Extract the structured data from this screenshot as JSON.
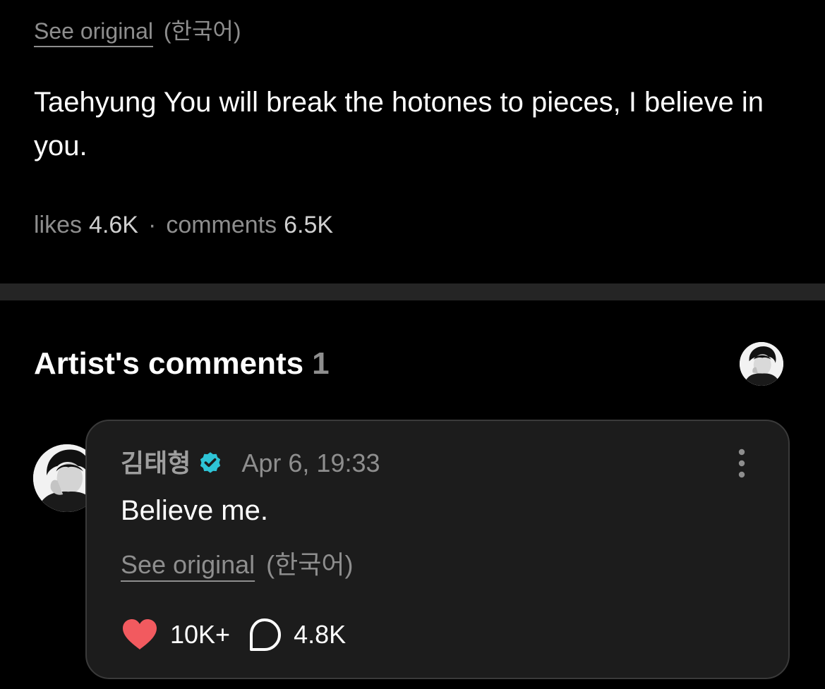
{
  "post": {
    "see_original_label": "See original",
    "original_language": "(한국어)",
    "text": "Taehyung You will break the hotones to pieces, I believe in you.",
    "stats": {
      "likes_label": "likes",
      "likes_count": "4.6K",
      "separator": "·",
      "comments_label": "comments",
      "comments_count": "6.5K"
    }
  },
  "artist_comments": {
    "heading": "Artist's comments",
    "count": "1",
    "comment": {
      "author": "김태형",
      "verified": true,
      "timestamp": "Apr 6, 19:33",
      "text": "Believe me.",
      "see_original_label": "See original",
      "original_language": "(한국어)",
      "likes": "10K+",
      "replies": "4.8K"
    }
  },
  "colors": {
    "background": "#000000",
    "card_background": "#1c1c1c",
    "divider": "#252525",
    "muted_text": "#8e8e8e",
    "heart": "#f25a5f",
    "verified_badge": "#2ec4d6"
  },
  "icons": {
    "verified": "verified-check-icon",
    "more": "more-vertical-icon",
    "heart": "heart-icon",
    "reply": "comment-bubble-icon",
    "avatar": "artist-avatar"
  }
}
